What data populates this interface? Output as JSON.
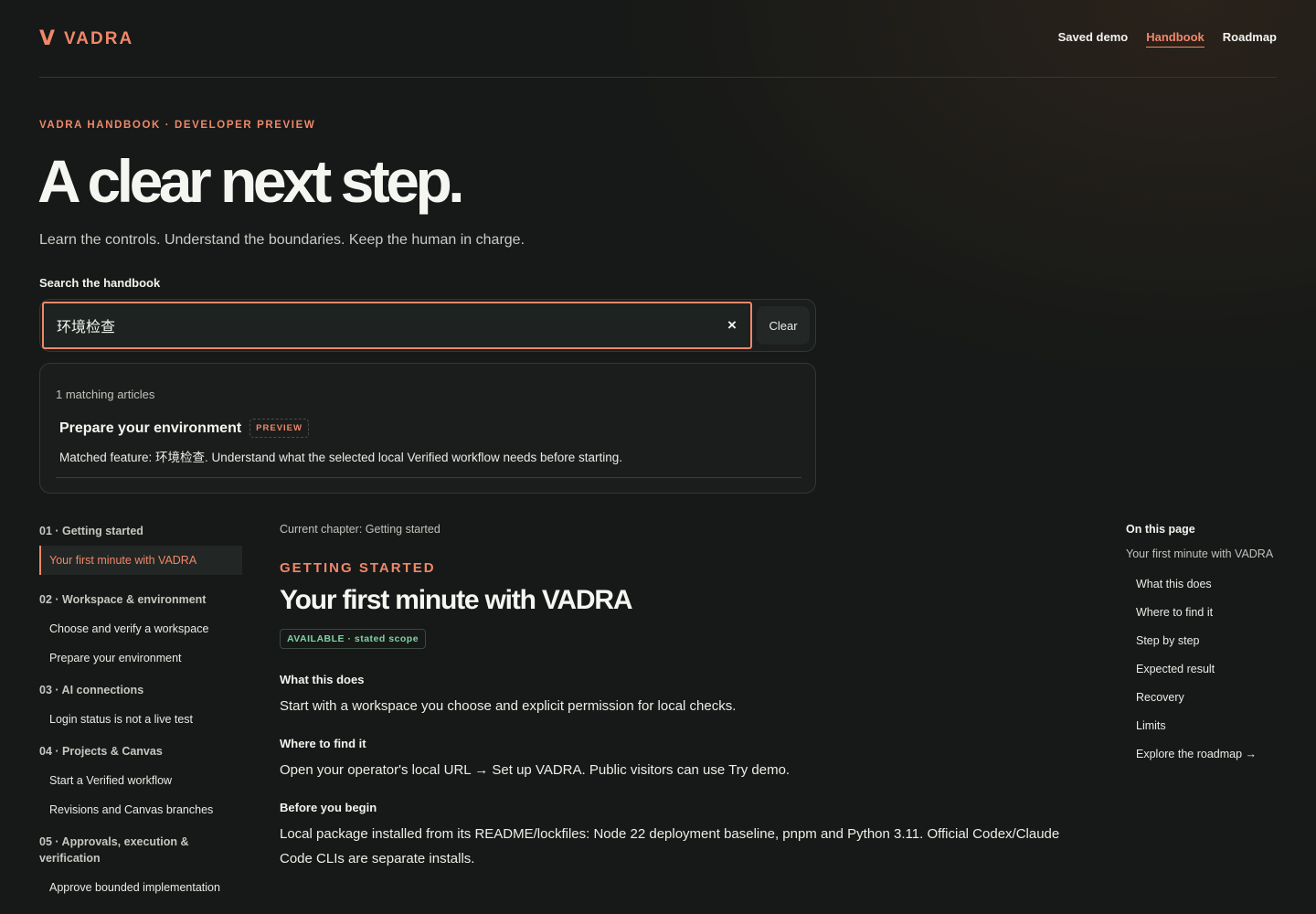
{
  "header": {
    "logo_mark": "V",
    "logo_text": "VADRA",
    "nav": [
      {
        "label": "Saved demo"
      },
      {
        "label": "Handbook"
      },
      {
        "label": "Roadmap"
      }
    ]
  },
  "hero": {
    "eyebrow": "VADRA HANDBOOK · DEVELOPER PREVIEW",
    "title": "A clear next step.",
    "subtitle": "Learn the controls. Understand the boundaries. Keep the human in charge."
  },
  "search": {
    "label": "Search the handbook",
    "value": "环境检查",
    "clear_icon": "×",
    "clear_label": "Clear"
  },
  "results": {
    "count_text": "1 matching articles",
    "items": [
      {
        "title": "Prepare your environment",
        "badge": "PREVIEW",
        "description": "Matched feature: 环境检查. Understand what the selected local Verified workflow needs before starting."
      }
    ]
  },
  "sidebar": {
    "groups": [
      {
        "title": "01 · Getting started",
        "items": [
          "Your first minute with VADRA"
        ]
      },
      {
        "title": "02 · Workspace & environment",
        "items": [
          "Choose and verify a workspace",
          "Prepare your environment"
        ]
      },
      {
        "title": "03 · AI connections",
        "items": [
          "Login status is not a live test"
        ]
      },
      {
        "title": "04 · Projects & Canvas",
        "items": [
          "Start a Verified workflow",
          "Revisions and Canvas branches"
        ]
      },
      {
        "title": "05 · Approvals, execution & verification",
        "items": [
          "Approve bounded implementation"
        ]
      }
    ]
  },
  "main": {
    "current_chapter": "Current chapter: Getting started",
    "chapter_eyebrow": "GETTING STARTED",
    "title": "Your first minute with VADRA",
    "status_badge": "AVAILABLE · stated scope",
    "sections": [
      {
        "heading": "What this does",
        "text": "Start with a workspace you choose and explicit permission for local checks."
      },
      {
        "heading": "Where to find it",
        "text": "Open your operator's local URL → Set up VADRA. Public visitors can use Try demo."
      },
      {
        "heading": "Before you begin",
        "text": "Local package installed from its README/lockfiles: Node 22 deployment baseline, pnpm and Python 3.11. Official Codex/Claude Code CLIs are separate installs."
      }
    ]
  },
  "toc": {
    "title": "On this page",
    "current": "Your first minute with VADRA",
    "items": [
      "What this does",
      "Where to find it",
      "Step by step",
      "Expected result",
      "Recovery",
      "Limits",
      "Explore the roadmap →"
    ]
  }
}
